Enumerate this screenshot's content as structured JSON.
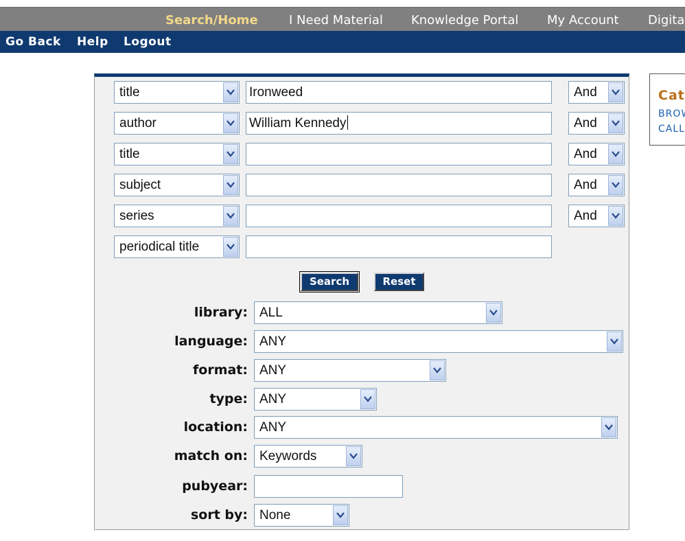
{
  "nav": {
    "items": [
      "Search/Home",
      "I Need Material",
      "Knowledge Portal",
      "My Account",
      "Digita"
    ],
    "active": "Search/Home"
  },
  "subnav": {
    "items": [
      "Go Back",
      "Help",
      "Logout"
    ]
  },
  "search": {
    "rows": [
      {
        "field": "title",
        "value": "Ironweed",
        "bool": "And"
      },
      {
        "field": "author",
        "value": "William Kennedy",
        "bool": "And"
      },
      {
        "field": "title",
        "value": "",
        "bool": "And"
      },
      {
        "field": "subject",
        "value": "",
        "bool": "And"
      },
      {
        "field": "series",
        "value": "",
        "bool": "And"
      },
      {
        "field": "periodical title",
        "value": ""
      }
    ],
    "search_label": "Search",
    "reset_label": "Reset"
  },
  "filters": {
    "library": {
      "label": "library:",
      "value": "ALL"
    },
    "language": {
      "label": "language:",
      "value": "ANY"
    },
    "format": {
      "label": "format:",
      "value": "ANY"
    },
    "type": {
      "label": "type:",
      "value": "ANY"
    },
    "location": {
      "label": "location:",
      "value": "ANY"
    },
    "match_on": {
      "label": "match on:",
      "value": "Keywords"
    },
    "pubyear": {
      "label": "pubyear:",
      "value": ""
    },
    "sort_by": {
      "label": "sort by:",
      "value": "None"
    }
  },
  "sidebox": {
    "heading": "Cat",
    "links": [
      "BROW",
      "CALL"
    ]
  },
  "colors": {
    "nav_bg": "#808080",
    "subnav_bg": "#0f3a70",
    "active_nav": "#f3d88a",
    "panel_bg": "#f1f1f1",
    "button_bg": "#0f3a70",
    "side_heading": "#b8701a",
    "side_link": "#1d5fae"
  }
}
